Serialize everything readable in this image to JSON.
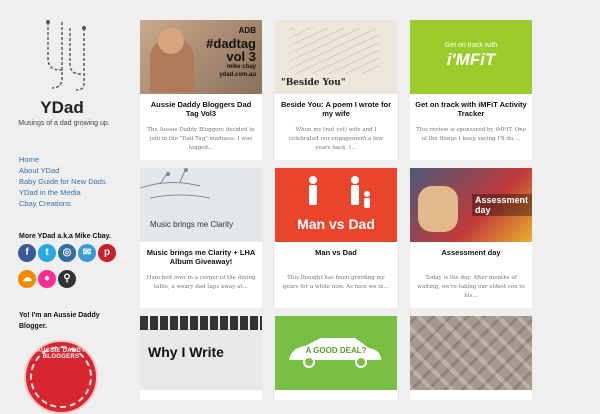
{
  "site": {
    "title": "YDad",
    "tagline": "Musings of a dad growing up."
  },
  "menu": [
    "Home",
    "About YDad",
    "Baby Guide for New Dads",
    "YDad in the Media",
    "Cbay Creations"
  ],
  "widgets": {
    "social_title": "More YDad a.k.a Mike Cbay.",
    "aussie_title": "Yo! I'm an Aussie Daddy Blogger.",
    "badge_text": "AUSSIE DADDY BLOGGERS"
  },
  "social_icons": [
    {
      "name": "facebook-icon",
      "glyph": "f",
      "color": "#3b5998"
    },
    {
      "name": "twitter-icon",
      "glyph": "t",
      "color": "#2aa9e0"
    },
    {
      "name": "instagram-icon",
      "glyph": "◎",
      "color": "#2f6e9e"
    },
    {
      "name": "email-icon",
      "glyph": "✉",
      "color": "#3b9bd6"
    },
    {
      "name": "pinterest-icon",
      "glyph": "p",
      "color": "#cb2027"
    },
    {
      "name": "soundcloud-icon",
      "glyph": "☁",
      "color": "#f08a00"
    },
    {
      "name": "flickr-icon",
      "glyph": "●",
      "color": "#ff2b92"
    },
    {
      "name": "search-icon",
      "glyph": "⚲",
      "color": "#333333"
    }
  ],
  "posts": [
    {
      "title": "Aussie Daddy Bloggers Dad Tag Vol3",
      "excerpt": "The Aussie Daddy Bloggers decided to join in the \"Dad Tag\" madness. I was tagged…",
      "thumb": "dadtag",
      "thumb_text": [
        "ADB",
        "#dadtag",
        "vol 3",
        "mike cbay",
        "ydad.com.au"
      ]
    },
    {
      "title": "Beside You: A poem I wrote for my wife",
      "excerpt": "When my (not yet) wife and I celebrated our engagement a few years back, I…",
      "thumb": "beside",
      "thumb_text": [
        "\"Beside You\""
      ]
    },
    {
      "title": "Get on track with iMFiT Activity Tracker",
      "excerpt": "This review is sponsored by iMFiT. One of the things I keep saying I'll do,…",
      "thumb": "imfit",
      "thumb_text": [
        "Get on track with",
        "i'MFiT"
      ]
    },
    {
      "title": "Music brings me Clarity + LHA Album Giveaway!",
      "excerpt": "Hunched over in a corner of the dining table, a weary dad taps away at…",
      "thumb": "music",
      "thumb_text": [
        "Music brings me Clarity"
      ]
    },
    {
      "title": "Man vs Dad",
      "excerpt": "This thought has been grinding my gears for a while now. As men we in…",
      "thumb": "manvsdad",
      "thumb_text": [
        "Man vs Dad"
      ]
    },
    {
      "title": "Assessment day",
      "excerpt": "Today is the day. After months of waiting, we're taking our eldest son to his…",
      "thumb": "assess",
      "thumb_text": [
        "Assessment day"
      ]
    },
    {
      "title": "",
      "excerpt": "",
      "thumb": "write",
      "thumb_text": [
        "Why I Write"
      ]
    },
    {
      "title": "",
      "excerpt": "",
      "thumb": "deal",
      "thumb_text": [
        "A GOOD DEAL?"
      ]
    },
    {
      "title": "",
      "excerpt": "",
      "thumb": "mat",
      "thumb_text": []
    }
  ]
}
